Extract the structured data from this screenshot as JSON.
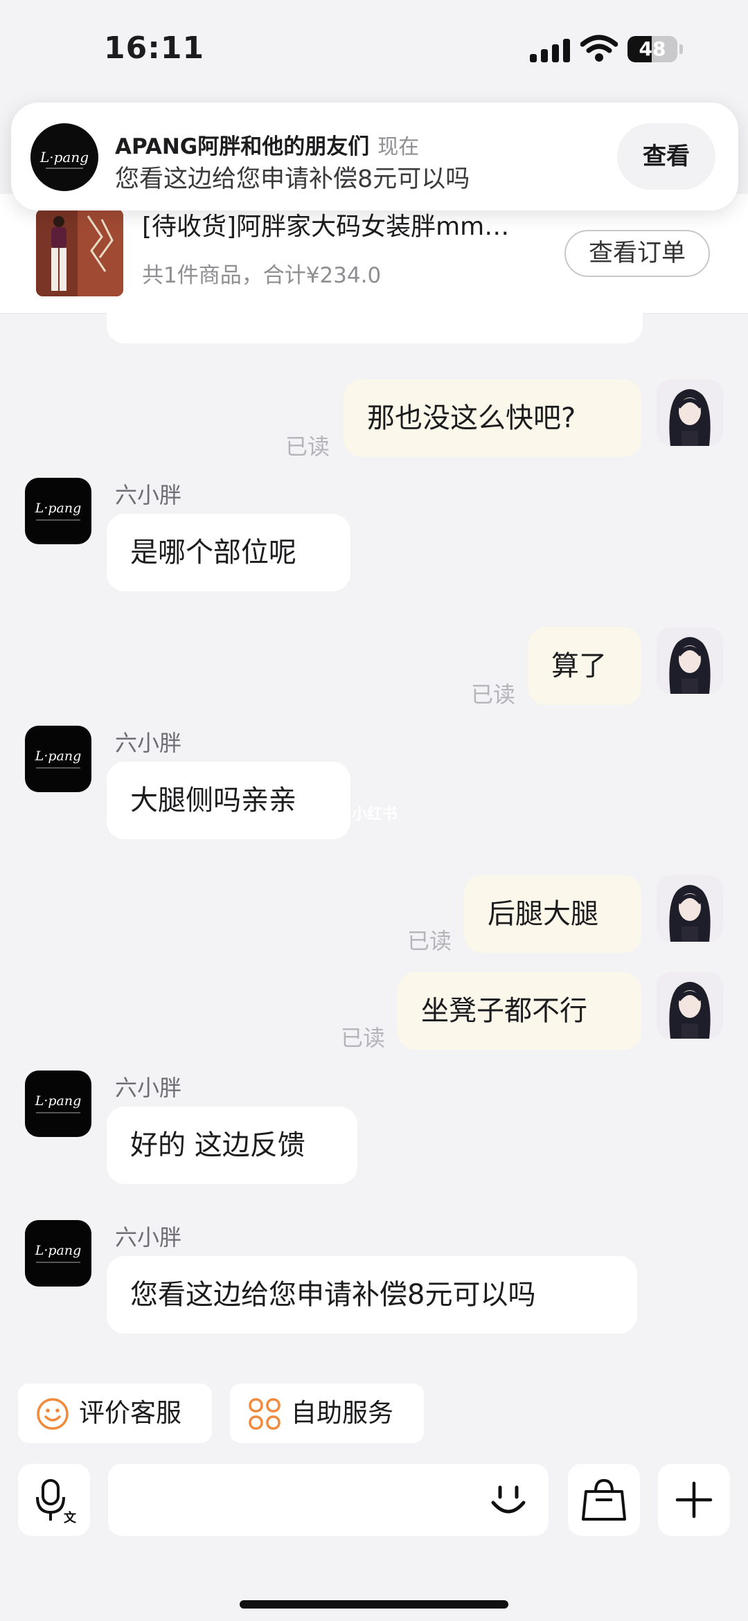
{
  "status_bar": {
    "time": "16:11",
    "battery_level": 48,
    "battery_label": "48"
  },
  "notification": {
    "sender": "APANG阿胖和他的朋友们",
    "time": "现在",
    "message": "您看这边给您申请补偿8元可以吗",
    "action_label": "查看",
    "avatar_text": "L·pang"
  },
  "order": {
    "title": "[待收货]阿胖家大码女装胖mm…",
    "summary": "共1件商品，合计¥234.0",
    "button_label": "查看订单"
  },
  "chat": {
    "messages": [
      {
        "from": "user",
        "text": "那也没这么快吧?",
        "status": "已读"
      },
      {
        "from": "agent",
        "name": "六小胖",
        "text": "是哪个部位呢"
      },
      {
        "from": "user",
        "text": "算了",
        "status": "已读"
      },
      {
        "from": "agent",
        "name": "六小胖",
        "text": "大腿侧吗亲亲"
      },
      {
        "from": "user",
        "text": "后腿大腿",
        "status": "已读"
      },
      {
        "from": "user",
        "text": "坐凳子都不行",
        "status": "已读"
      },
      {
        "from": "agent",
        "name": "六小胖",
        "text": "好的 这边反馈"
      },
      {
        "from": "agent",
        "name": "六小胖",
        "text": "您看这边给您申请补偿8元可以吗"
      }
    ],
    "agent_avatar_text": "L·pang",
    "watermark": "小红书"
  },
  "quick_actions": [
    {
      "label": "评价客服",
      "icon": "smile-icon"
    },
    {
      "label": "自助服务",
      "icon": "grid-flower-icon"
    }
  ],
  "input_bar": {
    "voice_icon": "voice-text-icon",
    "emoji_icon": "emoji-icon",
    "shop_icon": "shopping-bag-icon",
    "more_icon": "plus-icon"
  },
  "colors": {
    "background": "#f3f3f5",
    "outgoing_bubble": "#fbf7ea",
    "incoming_bubble": "#ffffff",
    "accent_orange": "#f08a3c"
  }
}
